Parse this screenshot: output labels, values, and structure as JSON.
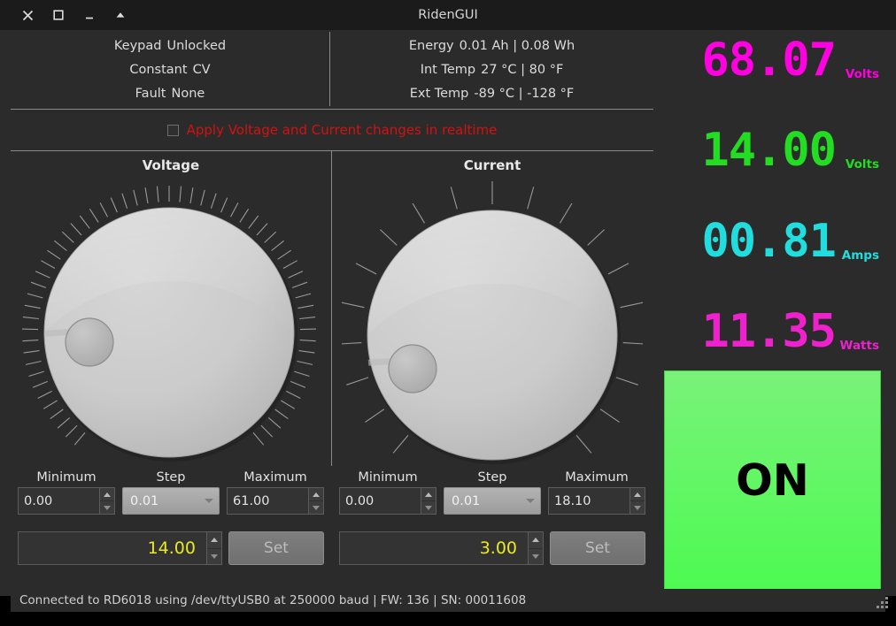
{
  "window": {
    "title": "RidenGUI",
    "buttons": [
      {
        "name": "close",
        "glyph": "close-icon"
      },
      {
        "name": "maximize",
        "glyph": "maximize-icon"
      },
      {
        "name": "minimize",
        "glyph": "minimize-icon"
      },
      {
        "name": "shade",
        "glyph": "caret-up-icon"
      }
    ]
  },
  "status": {
    "left": [
      {
        "label": "Keypad",
        "value": "Unlocked"
      },
      {
        "label": "Constant",
        "value": "CV"
      },
      {
        "label": "Fault",
        "value": "None"
      }
    ],
    "right": [
      {
        "label": "Energy",
        "value": "0.01 Ah | 0.08 Wh"
      },
      {
        "label": "Int Temp",
        "value": "27 °C | 80 °F"
      },
      {
        "label": "Ext Temp",
        "value": "-89 °C | -128 °F"
      }
    ]
  },
  "realtime": {
    "label": "Apply Voltage and Current changes in realtime",
    "checked": false,
    "color": "#d41111"
  },
  "voltage": {
    "title": "Voltage",
    "dial": {
      "ticks": 61,
      "angle_deg": 190
    },
    "minimum": {
      "label": "Minimum",
      "value": "0.00"
    },
    "step": {
      "label": "Step",
      "value": "0.01"
    },
    "maximum": {
      "label": "Maximum",
      "value": "61.00"
    },
    "set_value": "14.00",
    "set_label": "Set"
  },
  "current": {
    "title": "Current",
    "dial": {
      "ticks": 19,
      "angle_deg": 190
    },
    "minimum": {
      "label": "Minimum",
      "value": "0.00"
    },
    "step": {
      "label": "Step",
      "value": "0.01"
    },
    "maximum": {
      "label": "Maximum",
      "value": "18.10"
    },
    "set_value": "3.00",
    "set_label": "Set"
  },
  "readouts": [
    {
      "value": "68.07",
      "unit": "Volts",
      "color": "#ff00e0"
    },
    {
      "value": "14.00",
      "unit": "Volts",
      "color": "#22dd22"
    },
    {
      "value": "00.81",
      "unit": "Amps",
      "color": "#22dddd"
    },
    {
      "value": "11.35",
      "unit": "Watts",
      "color": "#ee22cc"
    }
  ],
  "output": {
    "label": "ON",
    "color": "#4dfa52"
  },
  "statusbar": {
    "message": "Connected to RD6018 using /dev/ttyUSB0 at 250000 baud | FW: 136 | SN: 00011608"
  }
}
